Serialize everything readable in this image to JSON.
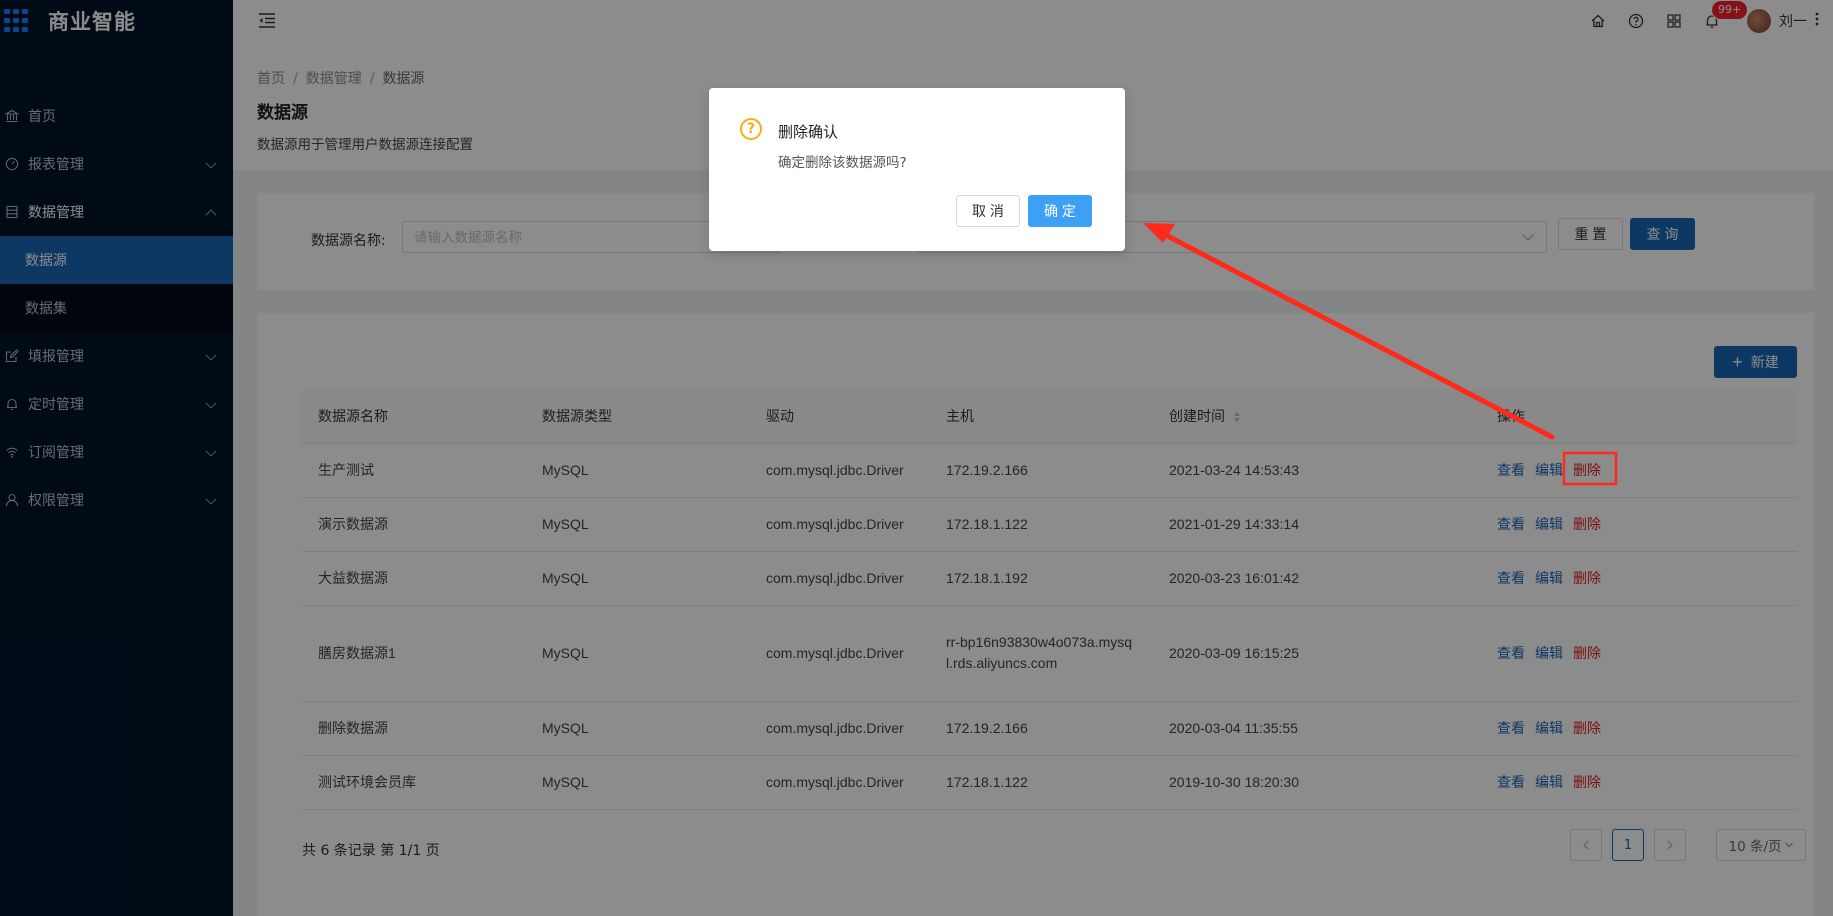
{
  "brand": {
    "name": "商业智能"
  },
  "sidebar": {
    "items": [
      {
        "label": "首页",
        "icon": "bank-icon"
      },
      {
        "label": "报表管理",
        "icon": "dashboard-icon"
      },
      {
        "label": "数据管理",
        "icon": "database-icon",
        "open": true,
        "children": [
          {
            "label": "数据源",
            "active": true
          },
          {
            "label": "数据集"
          }
        ]
      },
      {
        "label": "填报管理",
        "icon": "edit-icon"
      },
      {
        "label": "定时管理",
        "icon": "bell-icon"
      },
      {
        "label": "订阅管理",
        "icon": "wifi-icon"
      },
      {
        "label": "权限管理",
        "icon": "user-icon"
      }
    ]
  },
  "header": {
    "notification_count": "99+",
    "user_name": "刘一"
  },
  "breadcrumb": {
    "items": [
      "首页",
      "数据管理",
      "数据源"
    ]
  },
  "page": {
    "title": "数据源",
    "description": "数据源用于管理用户数据源连接配置"
  },
  "search": {
    "name_label": "数据源名称:",
    "name_placeholder": "请输入数据源名称",
    "reset_label": "重 置",
    "query_label": "查 询"
  },
  "table": {
    "new_label": "新建",
    "columns": [
      "数据源名称",
      "数据源类型",
      "驱动",
      "主机",
      "创建时间",
      "操作"
    ],
    "actions": {
      "view": "查看",
      "edit": "编辑",
      "delete": "删除"
    },
    "rows": [
      {
        "name": "生产测试",
        "type": "MySQL",
        "driver": "com.mysql.jdbc.Driver",
        "host": "172.19.2.166",
        "created": "2021-03-24 14:53:43"
      },
      {
        "name": "演示数据源",
        "type": "MySQL",
        "driver": "com.mysql.jdbc.Driver",
        "host": "172.18.1.122",
        "created": "2021-01-29 14:33:14"
      },
      {
        "name": "大益数据源",
        "type": "MySQL",
        "driver": "com.mysql.jdbc.Driver",
        "host": "172.18.1.192",
        "created": "2020-03-23 16:01:42"
      },
      {
        "name": "膳房数据源1",
        "type": "MySQL",
        "driver": "com.mysql.jdbc.Driver",
        "host": "rr-bp16n93830w4o073a.mysql.rds.aliyuncs.com",
        "created": "2020-03-09 16:15:25"
      },
      {
        "name": "删除数据源",
        "type": "MySQL",
        "driver": "com.mysql.jdbc.Driver",
        "host": "172.19.2.166",
        "created": "2020-03-04 11:35:55"
      },
      {
        "name": "测试环境会员库",
        "type": "MySQL",
        "driver": "com.mysql.jdbc.Driver",
        "host": "172.18.1.122",
        "created": "2019-10-30 18:20:30"
      }
    ]
  },
  "pagination": {
    "total_text": "共 6 条记录 第 1/1 页",
    "current_page": "1",
    "page_size": "10 条/页"
  },
  "modal": {
    "title": "删除确认",
    "content": "确定删除该数据源吗?",
    "cancel_label": "取 消",
    "ok_label": "确 定"
  },
  "colors": {
    "sidebar_bg": "#001529",
    "primary": "#1867b7",
    "danger": "#e02020",
    "warning": "#faad14",
    "annotation": "#ff2a1a"
  }
}
